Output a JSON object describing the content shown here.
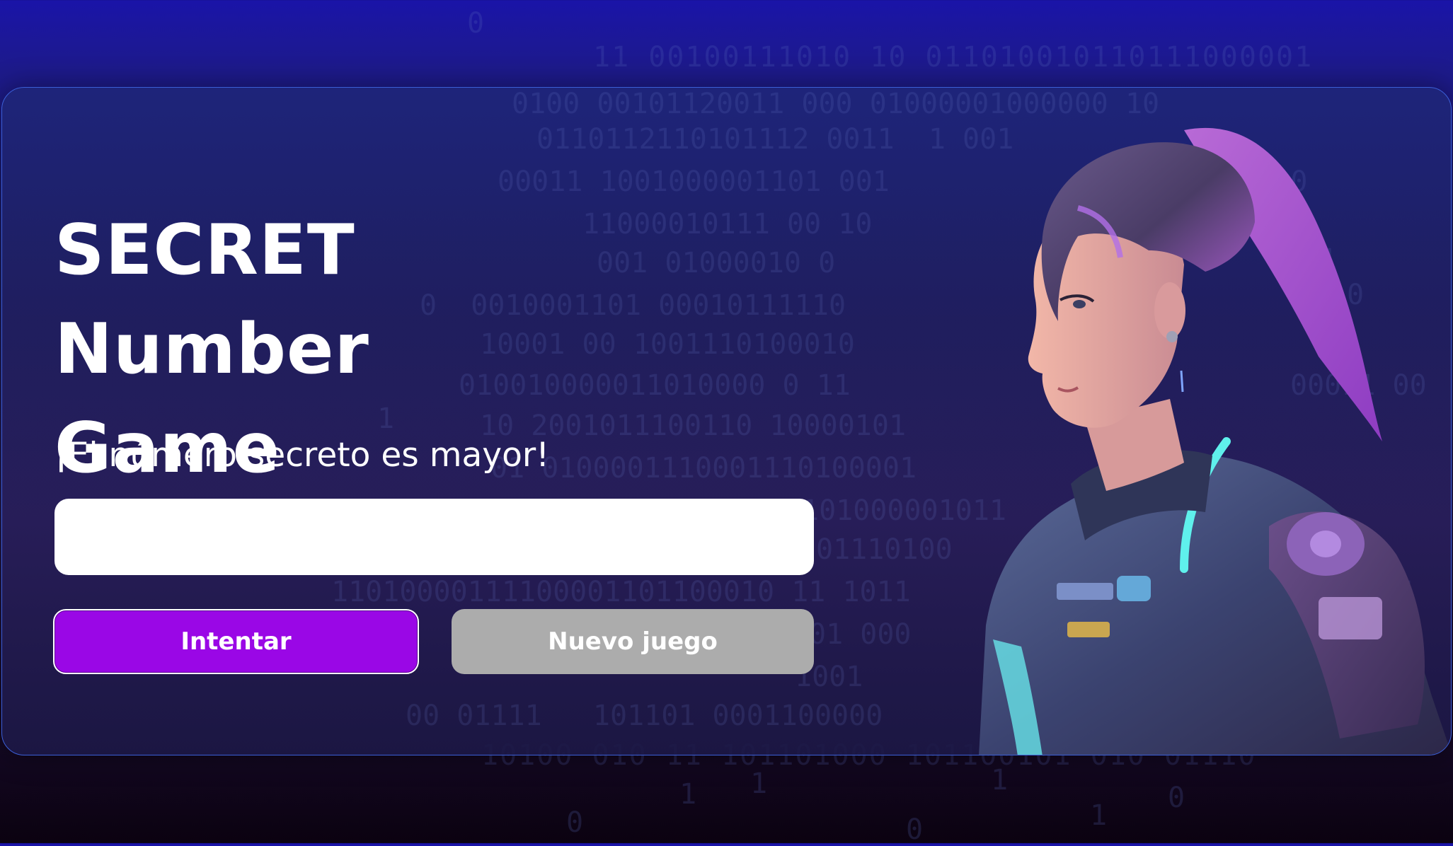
{
  "page": {
    "title": "SECRET Number Game",
    "message": "¡El número secreto es mayor!"
  },
  "guess_input": {
    "value": "",
    "placeholder": ""
  },
  "buttons": {
    "try_label": "Intentar",
    "new_game_label": "Nuevo juego"
  },
  "colors": {
    "try_button": "#9a07e6",
    "new_game_button": "#acacac",
    "card_border": "#3b5fd8"
  }
}
